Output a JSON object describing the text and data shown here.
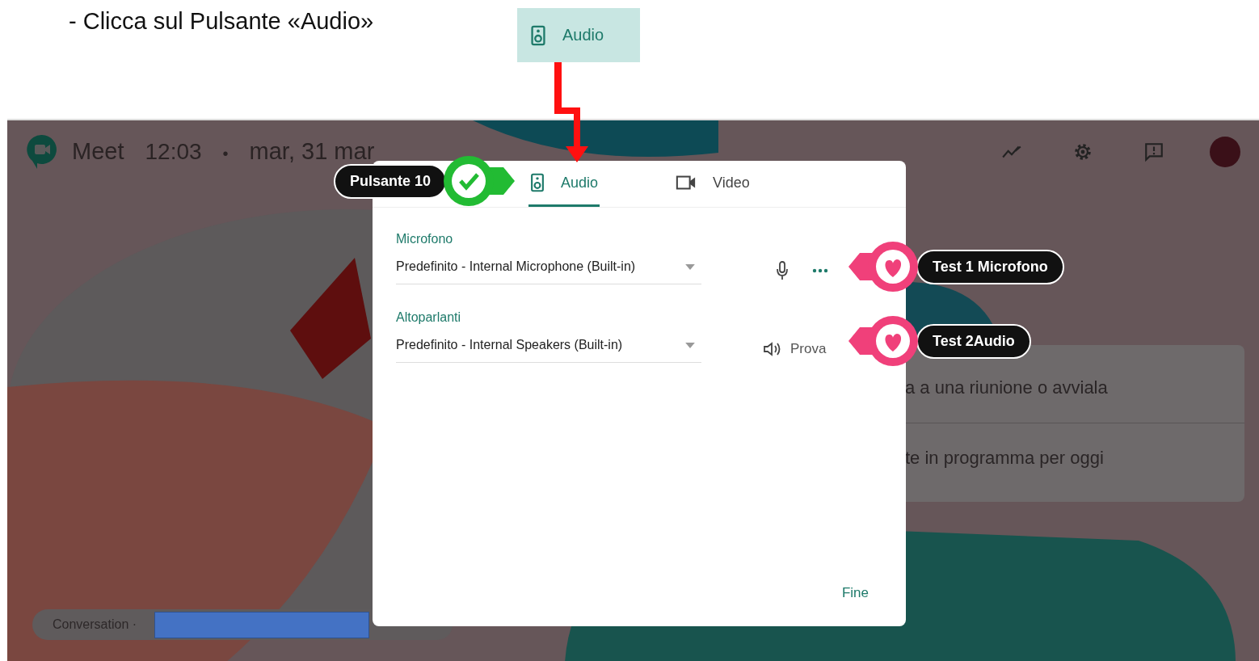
{
  "instruction": "- Clicca sul Pulsante «Audio»",
  "callout": {
    "label": "Audio"
  },
  "meet": {
    "app_name": "Meet",
    "time": "12:03",
    "separator": "•",
    "date": "mar, 31 mar"
  },
  "dialog": {
    "tabs": [
      {
        "label": "Audio",
        "kind": "speaker",
        "selected": true
      },
      {
        "label": "Video",
        "kind": "camera",
        "selected": false
      }
    ],
    "sections": [
      {
        "kind": "mic",
        "label": "Microfono",
        "value": "Predefinito - Internal Microphone (Built-in)"
      },
      {
        "kind": "speaker",
        "label": "Altoparlanti",
        "value": "Predefinito - Internal Speakers (Built-in)",
        "action": "Prova"
      }
    ],
    "done": "Fine"
  },
  "background_card": {
    "rows": [
      "a a una riunione o avviala",
      "te in programma per oggi"
    ]
  },
  "chip": {
    "label": "Conversation ·"
  },
  "annotations": [
    {
      "kind": "check",
      "label": "Pulsante 10",
      "color": "#22bb33"
    },
    {
      "kind": "heart",
      "label": "Test 1 Microfono",
      "color": "#f0407a"
    },
    {
      "kind": "heart",
      "label": "Test 2Audio",
      "color": "#f0407a"
    }
  ]
}
